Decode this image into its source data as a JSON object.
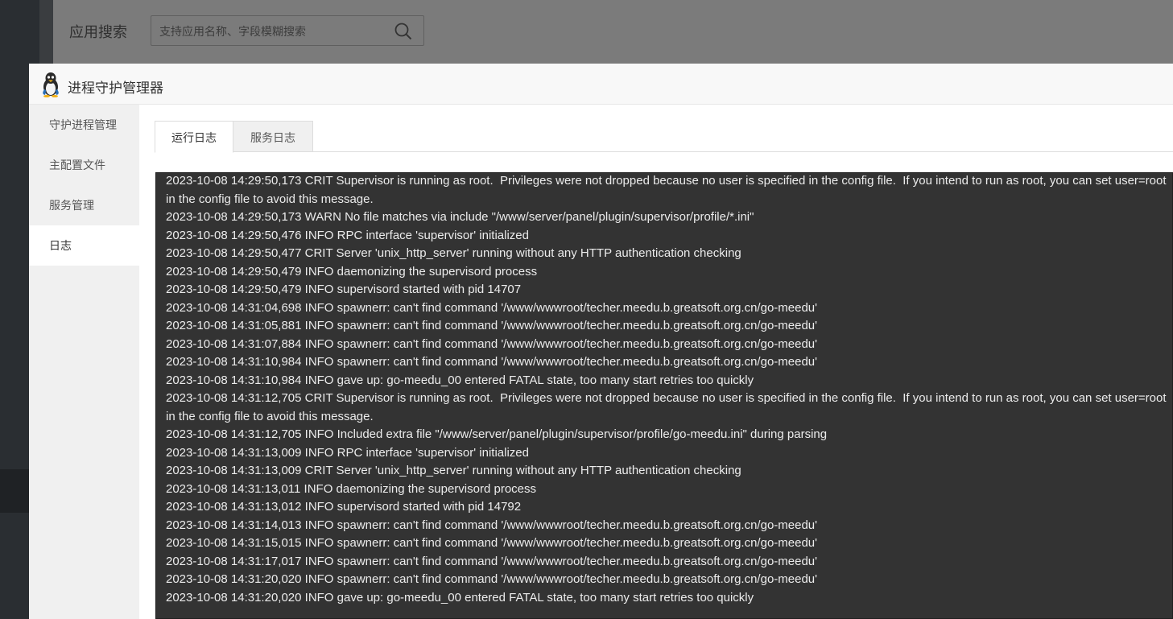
{
  "background": {
    "search_label": "应用搜索",
    "search_placeholder": "支持应用名称、字段模糊搜索",
    "search_icon": "search-icon"
  },
  "modal": {
    "title": "进程守护管理器",
    "logo_icon": "penguin-icon"
  },
  "sidebar": {
    "items": [
      {
        "label": "守护进程管理"
      },
      {
        "label": "主配置文件"
      },
      {
        "label": "服务管理"
      },
      {
        "label": "日志"
      }
    ],
    "active_index": 3
  },
  "tabs": [
    {
      "label": "运行日志"
    },
    {
      "label": "服务日志"
    }
  ],
  "log_lines": [
    "2023-10-08 14:29:50,173 CRIT Supervisor is running as root.  Privileges were not dropped because no user is specified in the config file.  If you intend to run as root, you can set user=root in the config file to avoid this message.",
    "2023-10-08 14:29:50,173 WARN No file matches via include \"/www/server/panel/plugin/supervisor/profile/*.ini\"",
    "2023-10-08 14:29:50,476 INFO RPC interface 'supervisor' initialized",
    "2023-10-08 14:29:50,477 CRIT Server 'unix_http_server' running without any HTTP authentication checking",
    "2023-10-08 14:29:50,479 INFO daemonizing the supervisord process",
    "2023-10-08 14:29:50,479 INFO supervisord started with pid 14707",
    "2023-10-08 14:31:04,698 INFO spawnerr: can't find command '/www/wwwroot/techer.meedu.b.greatsoft.org.cn/go-meedu'",
    "2023-10-08 14:31:05,881 INFO spawnerr: can't find command '/www/wwwroot/techer.meedu.b.greatsoft.org.cn/go-meedu'",
    "2023-10-08 14:31:07,884 INFO spawnerr: can't find command '/www/wwwroot/techer.meedu.b.greatsoft.org.cn/go-meedu'",
    "2023-10-08 14:31:10,984 INFO spawnerr: can't find command '/www/wwwroot/techer.meedu.b.greatsoft.org.cn/go-meedu'",
    "2023-10-08 14:31:10,984 INFO gave up: go-meedu_00 entered FATAL state, too many start retries too quickly",
    "2023-10-08 14:31:12,705 CRIT Supervisor is running as root.  Privileges were not dropped because no user is specified in the config file.  If you intend to run as root, you can set user=root in the config file to avoid this message.",
    "2023-10-08 14:31:12,705 INFO Included extra file \"/www/server/panel/plugin/supervisor/profile/go-meedu.ini\" during parsing",
    "2023-10-08 14:31:13,009 INFO RPC interface 'supervisor' initialized",
    "2023-10-08 14:31:13,009 CRIT Server 'unix_http_server' running without any HTTP authentication checking",
    "2023-10-08 14:31:13,011 INFO daemonizing the supervisord process",
    "2023-10-08 14:31:13,012 INFO supervisord started with pid 14792",
    "2023-10-08 14:31:14,013 INFO spawnerr: can't find command '/www/wwwroot/techer.meedu.b.greatsoft.org.cn/go-meedu'",
    "2023-10-08 14:31:15,015 INFO spawnerr: can't find command '/www/wwwroot/techer.meedu.b.greatsoft.org.cn/go-meedu'",
    "2023-10-08 14:31:17,017 INFO spawnerr: can't find command '/www/wwwroot/techer.meedu.b.greatsoft.org.cn/go-meedu'",
    "2023-10-08 14:31:20,020 INFO spawnerr: can't find command '/www/wwwroot/techer.meedu.b.greatsoft.org.cn/go-meedu'",
    "2023-10-08 14:31:20,020 INFO gave up: go-meedu_00 entered FATAL state, too many start retries too quickly"
  ]
}
